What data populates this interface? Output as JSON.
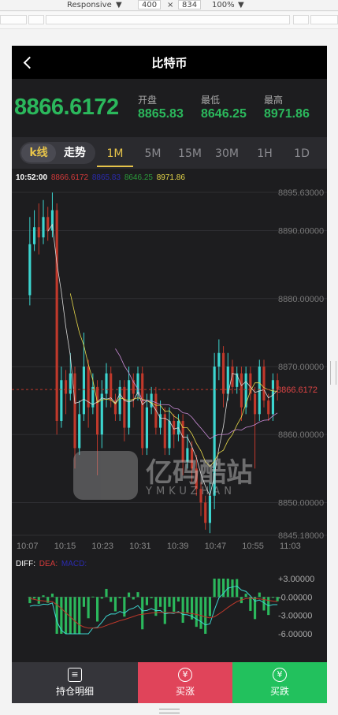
{
  "devtools": {
    "device": "Responsive",
    "width": "400",
    "times": "×",
    "height": "834",
    "zoom": "100%"
  },
  "header": {
    "title": "比特币"
  },
  "price": {
    "current": "8866.6172",
    "open_label": "开盘",
    "open": "8865.83",
    "low_label": "最低",
    "low": "8646.25",
    "high_label": "最高",
    "high": "8971.86"
  },
  "tabs": {
    "kline": "k线",
    "trend": "走势",
    "periods": [
      "1M",
      "5M",
      "15M",
      "30M",
      "1H",
      "1D"
    ],
    "active_period": "1M"
  },
  "legend": {
    "time": "10:52:00",
    "v1": "8866.6172",
    "v2": "8865.83",
    "v3": "8646.25",
    "v4": "8971.86",
    "c1": "#d43a3a",
    "c2": "#2b2bb0",
    "c3": "#2b9a3b",
    "c4": "#e6d84a"
  },
  "macd_legend": {
    "diff": "DIFF:",
    "dea": "DEA:",
    "macd": "MACD:"
  },
  "watermark": {
    "text": "亿码酷站",
    "sub": "YMKUZHAN"
  },
  "footer": {
    "hold": "持仓明细",
    "rise": "买涨",
    "fall": "买跌",
    "currency_glyph": "¥"
  },
  "colors": {
    "up": "#3cd6d0",
    "down": "#c0392b",
    "accent": "#e6c34a",
    "green": "#2bb85c"
  },
  "chart_data": {
    "type": "candlestick",
    "ylim": [
      8845.18,
      8895.63
    ],
    "yticks": [
      "8895.63000",
      "8890.00000",
      "8880.00000",
      "8870.00000",
      "8860.00000",
      "8850.00000",
      "8845.18000"
    ],
    "current_price_label": "8866.6172",
    "current_price": 8866.6172,
    "xticks": [
      "10:07",
      "10:15",
      "10:23",
      "10:31",
      "10:39",
      "10:47",
      "10:55",
      "11:03"
    ],
    "candles": [
      [
        8880.5,
        8888.0,
        8892.0,
        8879.0
      ],
      [
        8888.0,
        8890.5,
        8893.0,
        8887.0
      ],
      [
        8890.5,
        8889.0,
        8894.0,
        8886.5
      ],
      [
        8889.0,
        8892.0,
        8894.5,
        8888.0
      ],
      [
        8892.0,
        8890.0,
        8893.5,
        8888.5
      ],
      [
        8890.0,
        8893.0,
        8895.6,
        8889.0
      ],
      [
        8893.0,
        8862.0,
        8894.0,
        8860.0
      ],
      [
        8862.0,
        8868.0,
        8870.0,
        8861.0
      ],
      [
        8868.0,
        8866.0,
        8869.5,
        8863.0
      ],
      [
        8866.0,
        8869.0,
        8872.0,
        8865.0
      ],
      [
        8869.0,
        8858.0,
        8870.0,
        8855.0
      ],
      [
        8858.0,
        8863.0,
        8865.0,
        8857.0
      ],
      [
        8863.0,
        8870.0,
        8875.0,
        8862.0
      ],
      [
        8870.0,
        8864.0,
        8871.0,
        8861.0
      ],
      [
        8864.0,
        8867.0,
        8869.0,
        8863.0
      ],
      [
        8867.0,
        8860.0,
        8868.0,
        8854.0
      ],
      [
        8860.0,
        8866.0,
        8868.0,
        8858.0
      ],
      [
        8866.0,
        8869.0,
        8870.5,
        8864.0
      ],
      [
        8869.0,
        8865.0,
        8870.0,
        8864.0
      ],
      [
        8865.0,
        8863.0,
        8866.0,
        8862.0
      ],
      [
        8863.0,
        8867.0,
        8868.0,
        8862.0
      ],
      [
        8867.0,
        8861.0,
        8868.0,
        8859.0
      ],
      [
        8861.0,
        8868.0,
        8870.0,
        8860.0
      ],
      [
        8868.0,
        8866.0,
        8869.0,
        8864.0
      ],
      [
        8866.0,
        8869.0,
        8870.0,
        8865.0
      ],
      [
        8869.0,
        8858.0,
        8870.0,
        8857.0
      ],
      [
        8858.0,
        8864.0,
        8866.0,
        8857.0
      ],
      [
        8864.0,
        8866.0,
        8867.0,
        8863.0
      ],
      [
        8866.0,
        8861.0,
        8867.0,
        8860.0
      ],
      [
        8861.0,
        8863.0,
        8865.0,
        8860.0
      ],
      [
        8863.0,
        8858.0,
        8864.0,
        8857.0
      ],
      [
        8858.0,
        8862.0,
        8864.0,
        8857.0
      ],
      [
        8862.0,
        8860.0,
        8863.0,
        8858.0
      ],
      [
        8860.0,
        8862.0,
        8863.0,
        8859.0
      ],
      [
        8862.0,
        8856.0,
        8863.0,
        8854.0
      ],
      [
        8856.0,
        8858.0,
        8860.0,
        8855.0
      ],
      [
        8858.0,
        8855.0,
        8859.0,
        8853.0
      ],
      [
        8855.0,
        8852.0,
        8857.0,
        8851.0
      ],
      [
        8852.0,
        8850.0,
        8853.0,
        8848.0
      ],
      [
        8850.0,
        8847.0,
        8851.0,
        8846.0
      ],
      [
        8847.0,
        8851.0,
        8853.0,
        8845.5
      ],
      [
        8851.0,
        8870.0,
        8872.0,
        8849.0
      ],
      [
        8870.0,
        8872.0,
        8874.0,
        8868.0
      ],
      [
        8872.0,
        8866.0,
        8873.0,
        8864.0
      ],
      [
        8866.0,
        8870.0,
        8872.0,
        8865.0
      ],
      [
        8870.0,
        8867.0,
        8871.0,
        8866.0
      ],
      [
        8867.0,
        8869.0,
        8870.0,
        8866.0
      ],
      [
        8869.0,
        8864.0,
        8870.0,
        8862.0
      ],
      [
        8864.0,
        8869.0,
        8870.0,
        8863.0
      ],
      [
        8869.0,
        8866.0,
        8870.0,
        8865.0
      ],
      [
        8866.0,
        8863.0,
        8867.0,
        8855.0
      ],
      [
        8863.0,
        8870.0,
        8871.0,
        8862.0
      ],
      [
        8870.0,
        8865.0,
        8871.0,
        8864.0
      ],
      [
        8865.0,
        8863.0,
        8866.0,
        8862.0
      ],
      [
        8863.0,
        8868.0,
        8869.0,
        8862.0
      ],
      [
        8868.0,
        8866.6,
        8869.0,
        8865.0
      ]
    ],
    "candle_fields": [
      "open",
      "close",
      "high",
      "low"
    ],
    "macd": {
      "ylim": [
        -6.0,
        3.0
      ],
      "yticks": [
        "+3.00000",
        "-0.00000",
        "-3.00000",
        "-6.00000"
      ]
    }
  }
}
